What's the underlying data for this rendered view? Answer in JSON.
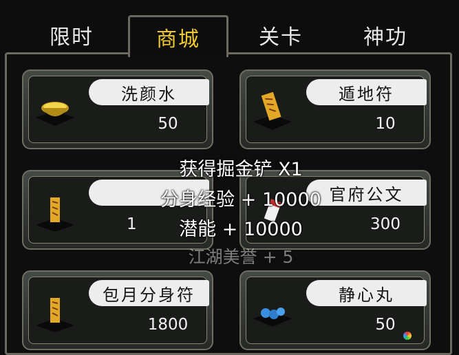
{
  "tabs": [
    {
      "label": "限时",
      "active": false
    },
    {
      "label": "商城",
      "active": true
    },
    {
      "label": "关卡",
      "active": false
    },
    {
      "label": "神功",
      "active": false
    }
  ],
  "items": [
    {
      "name": "洗颜水",
      "price": "50",
      "icon": "yellow-bowl-icon"
    },
    {
      "name": "遁地符",
      "price": "10",
      "icon": "talisman-icon"
    },
    {
      "name": "",
      "price": "1",
      "icon": "talisman-icon"
    },
    {
      "name": "官府公文",
      "price": "300",
      "icon": "document-icon"
    },
    {
      "name": "包月分身符",
      "price": "1800",
      "icon": "talisman-icon"
    },
    {
      "name": "静心丸",
      "price": "50",
      "icon": "blue-pill-icon"
    }
  ],
  "notice": {
    "line1_text": "获得掘金铲",
    "line1_suffix": " X1",
    "line2_text": "分身经验",
    "line2_suffix": " + 10000",
    "line3_text": "潜能",
    "line3_suffix": " + 10000",
    "line4_text": "江湖美誉",
    "line4_suffix": " + 5"
  },
  "colors": {
    "active_tab": "#f0c832",
    "card_border": "#6f6e63",
    "namebar": "#ededed"
  }
}
